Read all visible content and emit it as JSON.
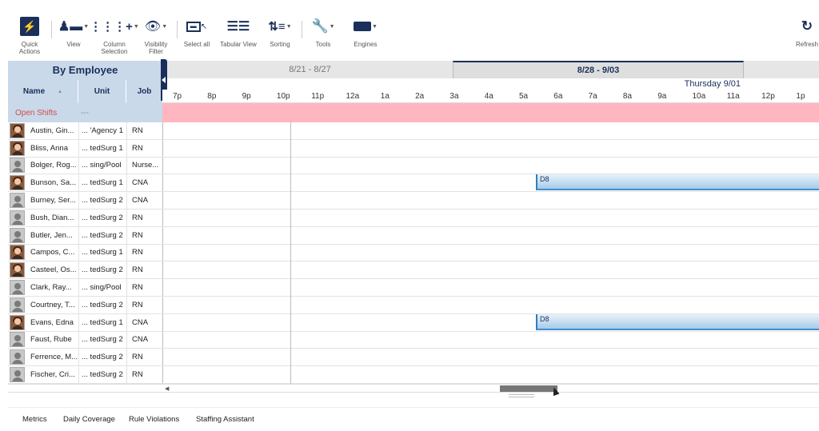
{
  "toolbar": {
    "items": [
      {
        "label": "Quick\nActions",
        "icon": "quick-actions-icon"
      },
      {
        "label": "View",
        "icon": "view-icon"
      },
      {
        "label": "Column\nSelection",
        "icon": "column-selection-icon"
      },
      {
        "label": "Visibility\nFilter",
        "icon": "eye-icon"
      },
      {
        "label": "Select all",
        "icon": "select-all-icon"
      },
      {
        "label": "Tabular View",
        "icon": "tabular-view-icon"
      },
      {
        "label": "Sorting",
        "icon": "sorting-icon"
      },
      {
        "label": "Tools",
        "icon": "wrench-icon"
      },
      {
        "label": "Engines",
        "icon": "engine-icon"
      },
      {
        "label": "Refresh",
        "icon": "refresh-icon"
      }
    ]
  },
  "left_panel": {
    "title": "By Employee",
    "columns": {
      "name": "Name",
      "unit": "Unit",
      "job": "Job"
    }
  },
  "weeks": [
    "8/21 - 8/27",
    "8/28 - 9/03"
  ],
  "day_label": "Thursday 9/01",
  "hours": [
    "7p",
    "8p",
    "9p",
    "10p",
    "11p",
    "12a",
    "1a",
    "2a",
    "3a",
    "4a",
    "5a",
    "6a",
    "7a",
    "8a",
    "9a",
    "10a",
    "11a",
    "12p",
    "1p"
  ],
  "open_shifts": {
    "label": "Open Shifts",
    "unit": "---"
  },
  "employees": [
    {
      "name": "Austin, Gin...",
      "unit": "... 'Agency 1",
      "job": "RN",
      "photo": true,
      "shift": ""
    },
    {
      "name": "Bliss, Anna",
      "unit": "... tedSurg 1",
      "job": "RN",
      "photo": true,
      "shift": ""
    },
    {
      "name": "Bolger, Rog...",
      "unit": "... sing/Pool",
      "job": "Nurse...",
      "photo": false,
      "shift": ""
    },
    {
      "name": "Bunson, Sa...",
      "unit": "... tedSurg 1",
      "job": "CNA",
      "photo": true,
      "shift": "D8"
    },
    {
      "name": "Burney, Ser...",
      "unit": "... tedSurg 2",
      "job": "CNA",
      "photo": false,
      "shift": ""
    },
    {
      "name": "Bush, Dian...",
      "unit": "... tedSurg 2",
      "job": "RN",
      "photo": false,
      "shift": ""
    },
    {
      "name": "Butler, Jen...",
      "unit": "... tedSurg 2",
      "job": "RN",
      "photo": false,
      "shift": ""
    },
    {
      "name": "Campos, C...",
      "unit": "... tedSurg 1",
      "job": "RN",
      "photo": true,
      "shift": ""
    },
    {
      "name": "Casteel, Os...",
      "unit": "... tedSurg 2",
      "job": "RN",
      "photo": true,
      "shift": ""
    },
    {
      "name": "Clark, Ray...",
      "unit": "... sing/Pool",
      "job": "RN",
      "photo": false,
      "shift": ""
    },
    {
      "name": "Courtney, T...",
      "unit": "... tedSurg 2",
      "job": "RN",
      "photo": false,
      "shift": ""
    },
    {
      "name": "Evans, Edna",
      "unit": "... tedSurg 1",
      "job": "CNA",
      "photo": true,
      "shift": "D8"
    },
    {
      "name": "Faust, Rube",
      "unit": "... tedSurg 2",
      "job": "CNA",
      "photo": false,
      "shift": ""
    },
    {
      "name": "Ferrence, M...",
      "unit": "... tedSurg 2",
      "job": "RN",
      "photo": false,
      "shift": ""
    },
    {
      "name": "Fischer, Cri...",
      "unit": "... tedSurg 2",
      "job": "RN",
      "photo": false,
      "shift": ""
    }
  ],
  "bottom_tabs": [
    "Metrics",
    "Daily Coverage",
    "Rule Violations",
    "Staffing Assistant"
  ],
  "colors": {
    "navy": "#1a2f5a",
    "header_blue": "#c9d9ea",
    "open_shift_pink": "#ffb6c1",
    "shift_blue": "#a6cbe8"
  }
}
